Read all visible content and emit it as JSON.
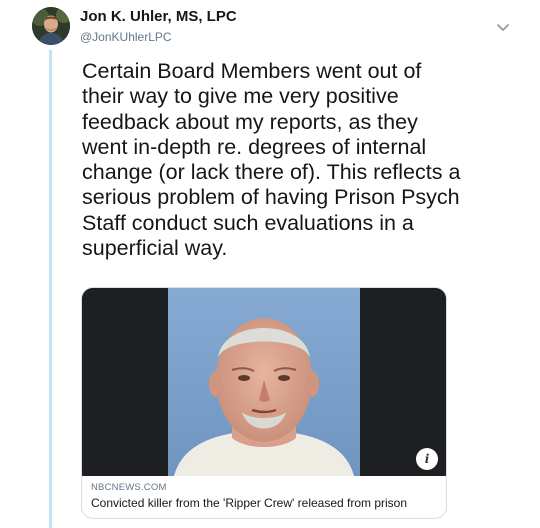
{
  "author": {
    "name": "Jon K. Uhler, MS, LPC",
    "handle": "@JonKUhlerLPC",
    "avatar_icon": "avatar-photo"
  },
  "tweet": {
    "text": "Certain Board Members went out of\ntheir way to give me very positive\nfeedback about my reports, as they\nwent in-depth re. degrees of internal\nchange (or lack there of). This reflects a\nserious problem of having Prison Psych\nStaff conduct such evaluations in a\nsuperficial way."
  },
  "card": {
    "domain": "NBCNEWS.COM",
    "title": "Convicted killer from the 'Ripper Crew' released from prison",
    "info_label": "i"
  },
  "colors": {
    "thread_line": "#c4e2f5",
    "image_background": "#7ea3cc",
    "card_sides": "#1e1f22"
  }
}
